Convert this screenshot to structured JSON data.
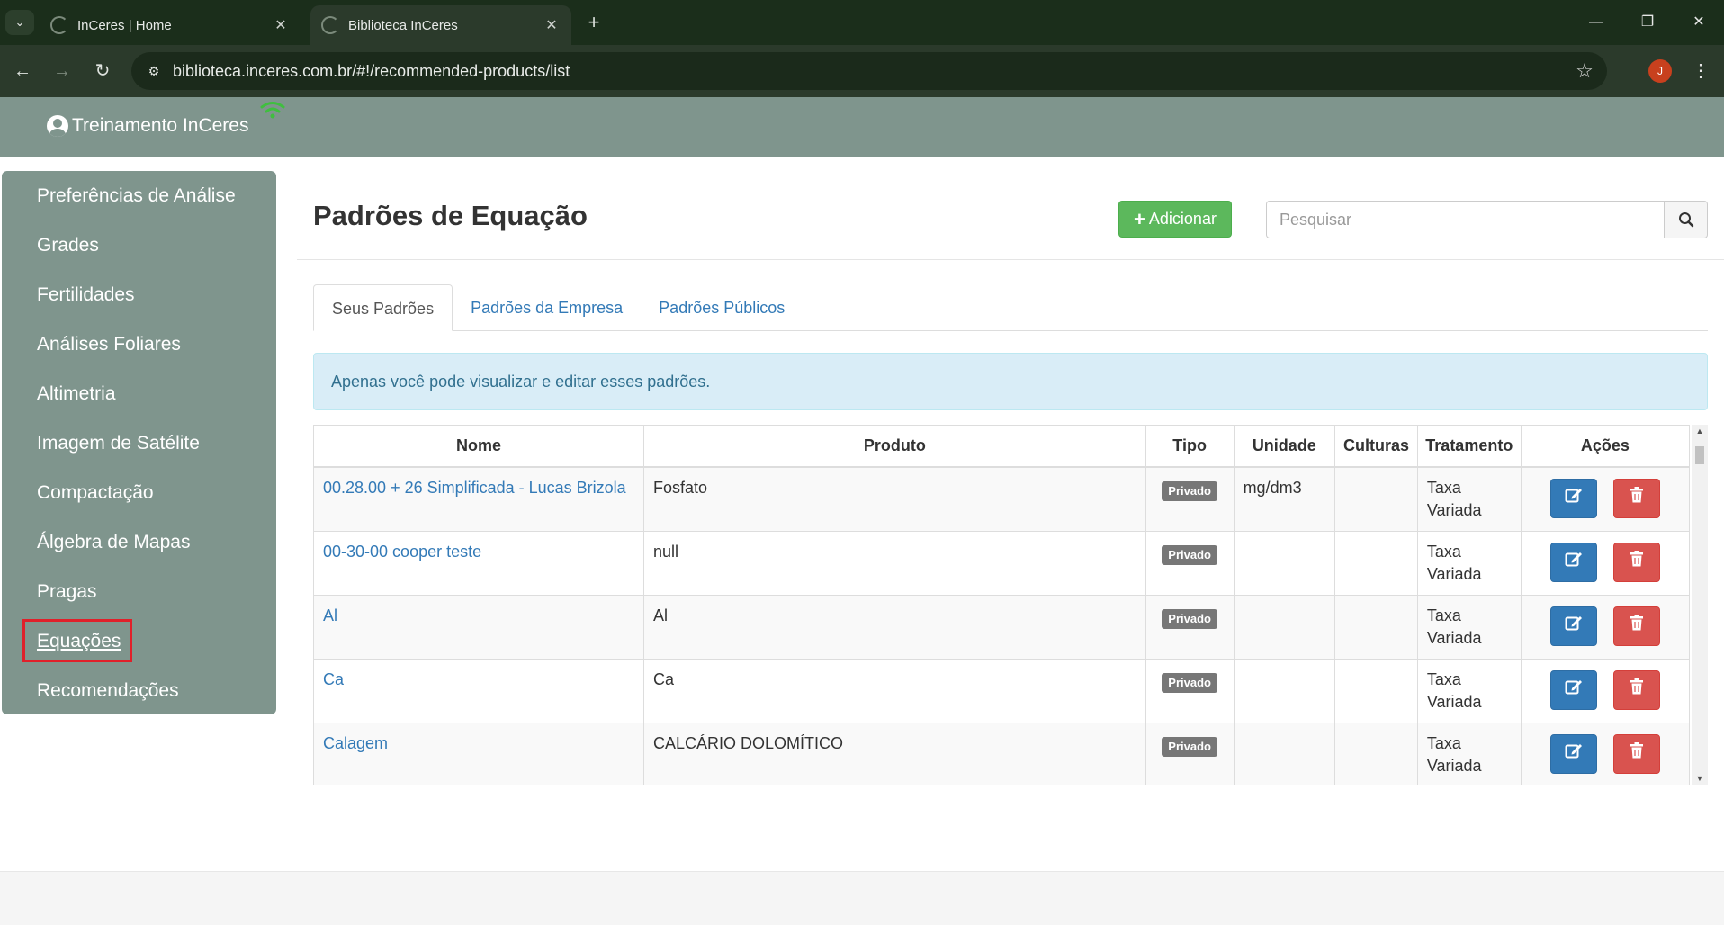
{
  "browser": {
    "tabs": [
      {
        "title": "InCeres | Home",
        "active": false
      },
      {
        "title": "Biblioteca InCeres",
        "active": true
      }
    ],
    "url": "biblioteca.inceres.com.br/#!/recommended-products/list",
    "profile_initial": "J"
  },
  "header": {
    "user_name": "Treinamento InCeres",
    "accent_color": "#7f958d"
  },
  "sidebar": {
    "items": [
      {
        "label": "Preferências de Análise"
      },
      {
        "label": "Grades"
      },
      {
        "label": "Fertilidades"
      },
      {
        "label": "Análises Foliares"
      },
      {
        "label": "Altimetria"
      },
      {
        "label": "Imagem de Satélite"
      },
      {
        "label": "Compactação"
      },
      {
        "label": "Álgebra de Mapas"
      },
      {
        "label": "Pragas"
      },
      {
        "label": "Equações",
        "active": true
      },
      {
        "label": "Recomendações"
      }
    ]
  },
  "main": {
    "title": "Padrões de Equação",
    "add_button": "Adicionar",
    "search_placeholder": "Pesquisar",
    "tabs": [
      {
        "label": "Seus Padrões",
        "active": true
      },
      {
        "label": "Padrões da Empresa"
      },
      {
        "label": "Padrões Públicos"
      }
    ],
    "info_text": "Apenas você pode visualizar e editar esses padrões.",
    "table": {
      "columns": [
        "Nome",
        "Produto",
        "Tipo",
        "Unidade",
        "Culturas",
        "Tratamento",
        "Ações"
      ],
      "rows": [
        {
          "nome": "00.28.00 + 26 Simplificada - Lucas Brizola",
          "produto": "Fosfato",
          "tipo": "Privado",
          "unidade": "mg/dm3",
          "culturas": "",
          "tratamento": "Taxa Variada"
        },
        {
          "nome": "00-30-00 cooper teste",
          "produto": "null",
          "tipo": "Privado",
          "unidade": "",
          "culturas": "",
          "tratamento": "Taxa Variada"
        },
        {
          "nome": "Al",
          "produto": "Al",
          "tipo": "Privado",
          "unidade": "",
          "culturas": "",
          "tratamento": "Taxa Variada"
        },
        {
          "nome": "Ca",
          "produto": "Ca",
          "tipo": "Privado",
          "unidade": "",
          "culturas": "",
          "tratamento": "Taxa Variada"
        },
        {
          "nome": "Calagem",
          "produto": "CALCÁRIO DOLOMÍTICO",
          "tipo": "Privado",
          "unidade": "",
          "culturas": "",
          "tratamento": "Taxa Variada"
        }
      ]
    }
  }
}
